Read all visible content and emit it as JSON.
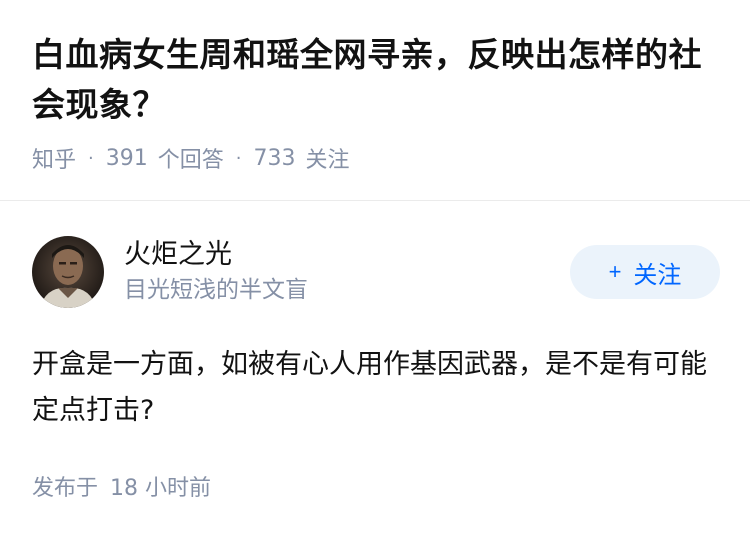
{
  "question": {
    "title": "白血病女生周和瑶全网寻亲，反映出怎样的社会现象？",
    "source": "知乎",
    "answers_count": "391",
    "answers_label": "个回答",
    "followers_count": "733",
    "followers_label": "关注"
  },
  "answer": {
    "author_name": "火炬之光",
    "author_bio": "目光短浅的半文盲",
    "follow_label": "关注",
    "follow_icon": "plus-icon",
    "content": "开盒是一方面，如被有心人用作基因武器，是不是有可能定点打击?",
    "time_label": "发布于",
    "time_value": "18 小时前"
  },
  "colors": {
    "text": "#121212",
    "meta": "#8590a6",
    "accent": "#0066ff",
    "follow_bg": "#ebf3fb",
    "divider": "#ebebeb"
  }
}
